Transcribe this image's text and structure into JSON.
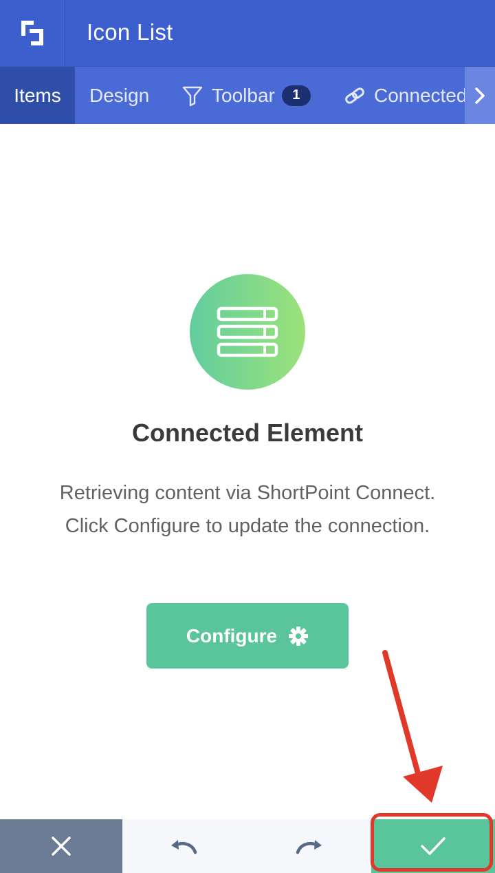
{
  "header": {
    "title": "Icon List",
    "logo_icon": "shortpoint-logo-icon"
  },
  "tabs": [
    {
      "label": "Items",
      "active": true
    },
    {
      "label": "Design",
      "active": false
    },
    {
      "label": "Toolbar",
      "icon": "filter-icon",
      "badge": "1",
      "active": false
    },
    {
      "label": "Connected",
      "icon": "link-icon",
      "active": false
    }
  ],
  "tabs_more_icon": "chevron-right-icon",
  "connected": {
    "icon": "list-rows-icon",
    "heading": "Connected Element",
    "description": "Retrieving content via ShortPoint Connect. Click Configure to update the connection.",
    "configure_label": "Configure",
    "configure_icon": "gear-icon"
  },
  "footer": {
    "cancel_icon": "close-icon",
    "undo_icon": "undo-icon",
    "redo_icon": "redo-icon",
    "confirm_icon": "check-icon"
  },
  "colors": {
    "header": "#3d5fce",
    "tabs_bg": "#4a6bd6",
    "tab_active": "#2f4ea8",
    "accent_green": "#5ac49a",
    "annotation_red": "#e0392a"
  }
}
